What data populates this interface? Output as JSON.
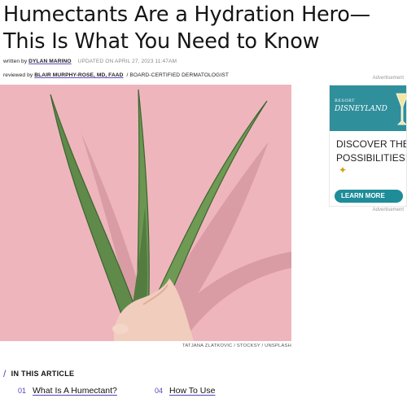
{
  "article": {
    "title": "Humectants Are a Hydration Hero—This Is What You Need to Know",
    "byline": {
      "written_prefix": "written by",
      "author": "DYLAN MARINO",
      "updated": "UPDATED ON APRIL 27, 2023 11:47AM",
      "reviewed_prefix": "reviewed by",
      "reviewer": "BLAIR MURPHY-ROSE, MD, FAAD",
      "reviewer_role": "/ BOARD-CERTIFIED DERMATOLOGIST"
    },
    "image_credit": "TATJANA ZLATKOVIC / STOCKSY / UNSPLASH"
  },
  "ad": {
    "label": "Advertisement",
    "brand_top": "DISNEYLAND",
    "brand_small": "RESORT",
    "headline_line1": "DISCOVER THE",
    "headline_line2": "POSSIBILITIES!",
    "sparkle": "✦",
    "button": "LEARN MORE"
  },
  "in_this_article": {
    "heading": "IN THIS ARTICLE",
    "slash": "/",
    "items": [
      {
        "num": "01",
        "title": "What Is A Humectant?"
      },
      {
        "num": "04",
        "title": "How To Use"
      }
    ]
  },
  "colors": {
    "accent": "#5b3fc0",
    "hero_bg": "#eeb6bc",
    "ad_teal": "#2f8f9b"
  }
}
